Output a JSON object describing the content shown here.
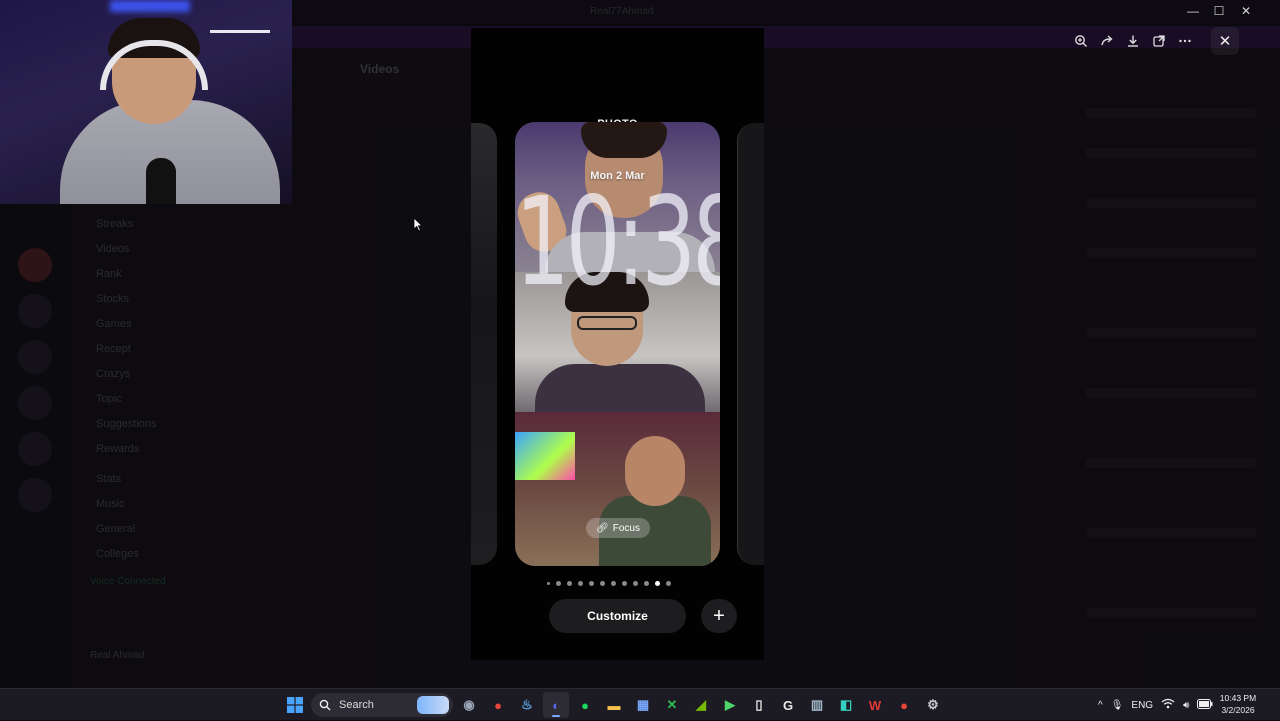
{
  "window": {
    "title": "Real77Ahmad",
    "controls": [
      "—",
      "☐",
      "✕"
    ]
  },
  "background_app": {
    "channel_title": "Videos",
    "channels": [
      "Streaks",
      "Videos",
      "Rank",
      "Stocks",
      "Games",
      "Recept",
      "Crazys",
      "Topic",
      "Suggestions",
      "Rewards",
      "Stats",
      "Music",
      "General",
      "Colleges"
    ],
    "voice_status": "Voice Connected",
    "username": "Real Ahmad"
  },
  "viewer": {
    "tools": [
      "zoom-in-icon",
      "share-icon",
      "download-icon",
      "open-external-icon",
      "more-icon"
    ],
    "close_label": "✕"
  },
  "wallpaper": {
    "label": "PHOTO",
    "date": "Mon 2 Mar",
    "time": "10:38",
    "focus_label": "Focus",
    "page_count": 12,
    "active_page": 11,
    "customize_label": "Customize",
    "add_label": "+"
  },
  "taskbar": {
    "search_placeholder": "Search",
    "apps": [
      {
        "name": "camera",
        "color": "#9aa4b8",
        "glyph": "◉"
      },
      {
        "name": "chrome",
        "color": "#e8453c",
        "glyph": "●"
      },
      {
        "name": "steam",
        "color": "#5fa8e8",
        "glyph": "♨"
      },
      {
        "name": "discord",
        "color": "#5865f2",
        "glyph": "◐"
      },
      {
        "name": "spotify",
        "color": "#1ed760",
        "glyph": "●"
      },
      {
        "name": "files",
        "color": "#f2c14e",
        "glyph": "▬"
      },
      {
        "name": "store",
        "color": "#7aa8ff",
        "glyph": "▦"
      },
      {
        "name": "xbox",
        "color": "#2dbd4e",
        "glyph": "✕"
      },
      {
        "name": "nvidia",
        "color": "#76b900",
        "glyph": "◢"
      },
      {
        "name": "play",
        "color": "#4fd36a",
        "glyph": "▶"
      },
      {
        "name": "document",
        "color": "#e8e8e8",
        "glyph": "▯"
      },
      {
        "name": "g-hub",
        "color": "#e8e8e8",
        "glyph": "G"
      },
      {
        "name": "recycle",
        "color": "#9fb7c9",
        "glyph": "▥"
      },
      {
        "name": "capcut",
        "color": "#33d0c0",
        "glyph": "◧"
      },
      {
        "name": "wps",
        "color": "#e03a3a",
        "glyph": "W"
      },
      {
        "name": "chrome-2",
        "color": "#e8453c",
        "glyph": "●"
      },
      {
        "name": "settings",
        "color": "#c4c7cf",
        "glyph": "⚙"
      }
    ],
    "tray": {
      "chevron": "^",
      "language": "ENG",
      "time": "10:43 PM",
      "date": "3/2/2026"
    }
  }
}
